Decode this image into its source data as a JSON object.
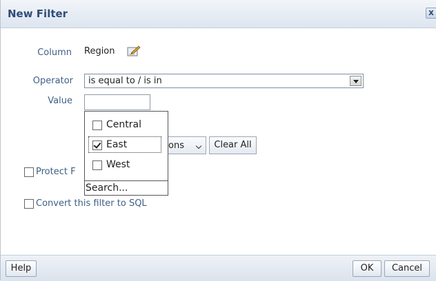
{
  "dialog": {
    "title": "New Filter",
    "close_glyph": "x"
  },
  "form": {
    "column_label": "Column",
    "column_value": "Region",
    "operator_label": "Operator",
    "operator_value": "is equal to / is in",
    "value_label": "Value",
    "value_input": ""
  },
  "dropdown": {
    "items": [
      {
        "label": "Central",
        "checked": false
      },
      {
        "label": "East",
        "checked": true
      },
      {
        "label": "West",
        "checked": false
      }
    ],
    "search_label": "Search..."
  },
  "buttons": {
    "options_partial": "ons",
    "clear_all": "Clear All"
  },
  "checkboxes": {
    "protect_partial": "Protect F",
    "convert_sql": "Convert this filter to SQL"
  },
  "footer": {
    "help": "Help",
    "ok": "OK",
    "cancel": "Cancel"
  },
  "icons": {
    "edit": "edit-pencil-icon",
    "close": "close-icon",
    "dropdown_arrow": "chevron-down-icon"
  },
  "colors": {
    "title": "#2f4d77",
    "label": "#3f5f86"
  }
}
